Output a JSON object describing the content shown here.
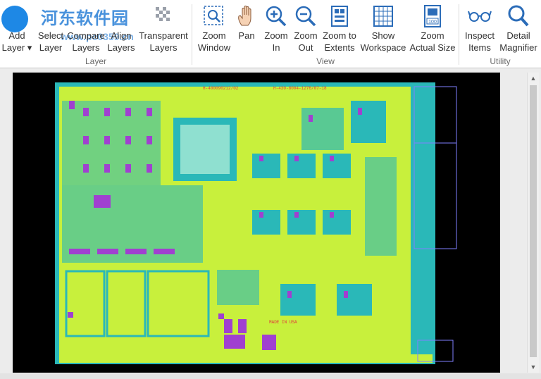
{
  "watermark": {
    "text": "河东软件园",
    "sub_text": "www.pc0359.cn"
  },
  "ribbon": {
    "groups": [
      {
        "label": "Layer",
        "buttons": [
          {
            "name": "add-layer",
            "label": "Add\nLayer ▾",
            "icon": "add-layer-icon"
          },
          {
            "name": "select-layer",
            "label": "Select\nLayer",
            "icon": "select-layer-icon"
          },
          {
            "name": "compare-layers",
            "label": "Compare\nLayers",
            "icon": "compare-layers-icon"
          },
          {
            "name": "align-layers",
            "label": "Align\nLayers",
            "icon": "align-layers-icon"
          },
          {
            "name": "transparent-layers",
            "label": "Transparent\nLayers",
            "icon": "transparent-layers-icon"
          }
        ]
      },
      {
        "label": "View",
        "buttons": [
          {
            "name": "zoom-window",
            "label": "Zoom\nWindow",
            "icon": "zoom-window-icon"
          },
          {
            "name": "pan",
            "label": "Pan",
            "icon": "pan-hand-icon"
          },
          {
            "name": "zoom-in",
            "label": "Zoom\nIn",
            "icon": "zoom-in-icon"
          },
          {
            "name": "zoom-out",
            "label": "Zoom\nOut",
            "icon": "zoom-out-icon"
          },
          {
            "name": "zoom-to-extents",
            "label": "Zoom to\nExtents",
            "icon": "zoom-extents-icon"
          },
          {
            "name": "show-workspace",
            "label": "Show\nWorkspace",
            "icon": "show-workspace-icon"
          },
          {
            "name": "zoom-actual-size",
            "label": "Zoom\nActual Size",
            "icon": "zoom-actual-size-icon"
          }
        ]
      },
      {
        "label": "Utility",
        "buttons": [
          {
            "name": "inspect-items",
            "label": "Inspect\nItems",
            "icon": "glasses-icon"
          },
          {
            "name": "detail-magnifier",
            "label": "Detail\nMagnifier",
            "icon": "magnifier-icon"
          }
        ]
      }
    ]
  },
  "board": {
    "part_number_1": "H-400090212/02",
    "part_number_2": "H-430-8004-1276/07-18",
    "made_in": "MADE IN USA",
    "colors": {
      "background": "#000000",
      "board": "#c8f03c",
      "copper": "#2ab8b8",
      "pads": "#a040d0",
      "accent": "#e23b3b",
      "outline": "#8080ff"
    }
  }
}
